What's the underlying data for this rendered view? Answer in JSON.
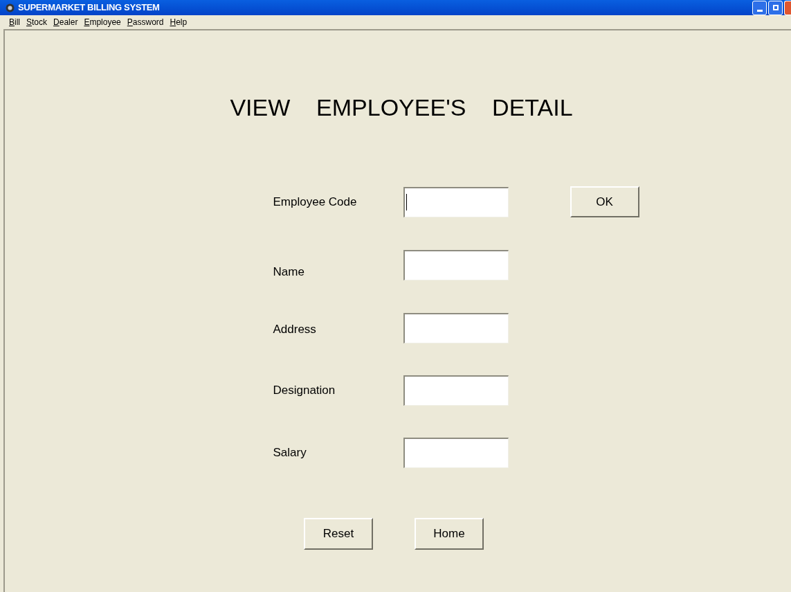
{
  "window": {
    "title": "SUPERMARKET BILLING SYSTEM"
  },
  "menu": [
    "Bill",
    "Stock",
    "Dealer",
    "Employee",
    "Password",
    "Help"
  ],
  "heading": "VIEW    EMPLOYEE'S    DETAIL",
  "fields": [
    {
      "label": "Employee Code",
      "focused": true
    },
    {
      "label": "Name",
      "focused": false
    },
    {
      "label": "Address",
      "focused": false
    },
    {
      "label": "Designation",
      "focused": false
    },
    {
      "label": "Salary",
      "focused": false
    }
  ],
  "ok_button": "OK",
  "buttons": [
    "Reset",
    "Home"
  ]
}
